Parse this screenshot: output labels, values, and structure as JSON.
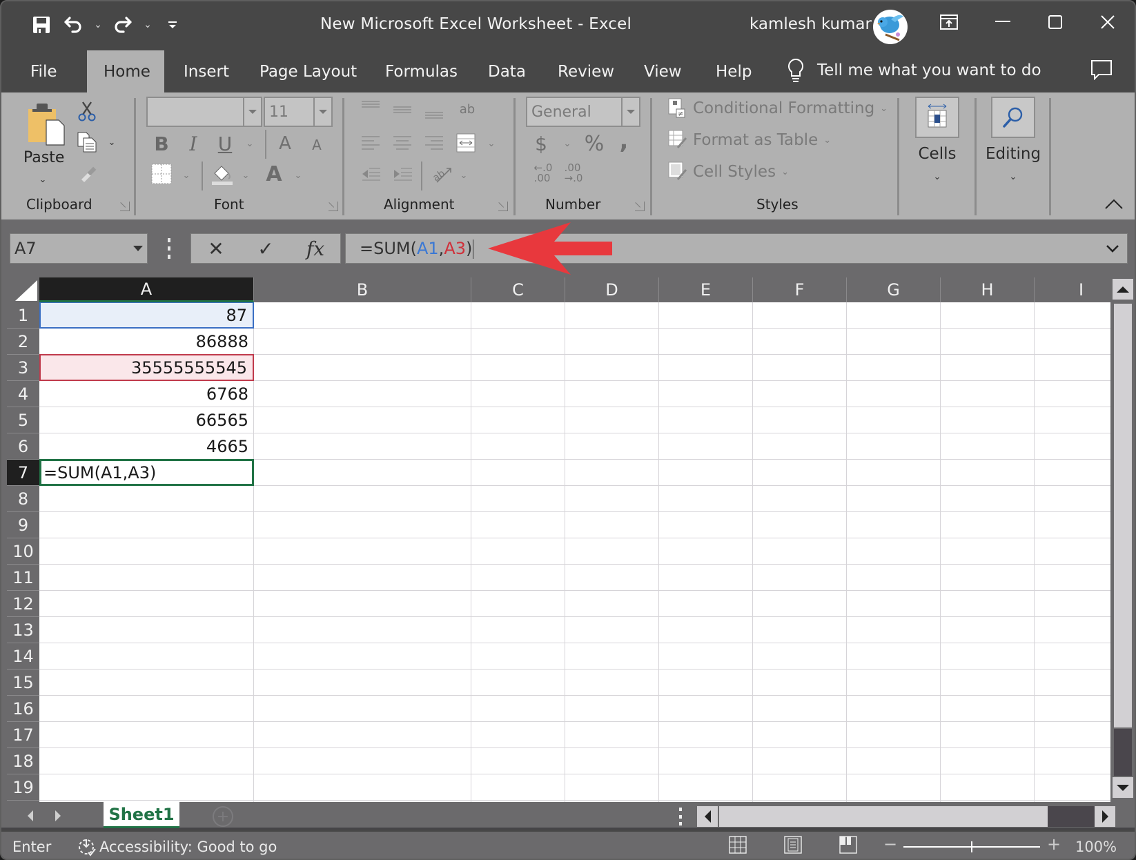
{
  "window": {
    "title": "New Microsoft Excel Worksheet  -  Excel",
    "user_name": "kamlesh kumar"
  },
  "quick_access": {
    "save": "save-icon",
    "undo": "undo-icon",
    "redo": "redo-icon",
    "customize": "customize-toolbar-icon"
  },
  "tabs": [
    {
      "label": "File"
    },
    {
      "label": "Home",
      "active": true
    },
    {
      "label": "Insert"
    },
    {
      "label": "Page Layout"
    },
    {
      "label": "Formulas"
    },
    {
      "label": "Data"
    },
    {
      "label": "Review"
    },
    {
      "label": "View"
    },
    {
      "label": "Help"
    }
  ],
  "tell_me": {
    "placeholder": "Tell me what you want to do"
  },
  "ribbon": {
    "clipboard": {
      "label": "Clipboard",
      "paste_label": "Paste"
    },
    "font": {
      "label": "Font",
      "font_name": "",
      "font_size": "11",
      "bold": "B",
      "italic": "I",
      "underline": "U",
      "grow": "A",
      "shrink": "A",
      "font_color": "A"
    },
    "alignment": {
      "label": "Alignment",
      "wrap": "ab"
    },
    "number": {
      "label": "Number",
      "format": "General",
      "currency": "$",
      "percent": "%",
      "comma": ",",
      "inc_decimal": "←.0\n.00",
      "dec_decimal": ".00\n→.0"
    },
    "styles": {
      "label": "Styles",
      "conditional_formatting": "Conditional Formatting",
      "format_as_table": "Format as Table",
      "cell_styles": "Cell Styles"
    },
    "cells": {
      "label": "Cells"
    },
    "editing": {
      "label": "Editing"
    }
  },
  "formula_bar": {
    "name_box": "A7",
    "cancel": "✕",
    "enter": "✓",
    "fx": "fx",
    "formula_prefix": "=SUM(",
    "ref1": "A1",
    "comma": ",",
    "ref2": "A3",
    "formula_suffix": ")"
  },
  "colors": {
    "ref1": "#3a78d4",
    "ref2": "#d0303a",
    "excel_green": "#217346",
    "annotation_arrow": "#e8383d"
  },
  "sheet": {
    "columns": [
      "A",
      "B",
      "C",
      "D",
      "E",
      "F",
      "G",
      "H",
      "I"
    ],
    "rows": [
      "1",
      "2",
      "3",
      "4",
      "5",
      "6",
      "7",
      "8",
      "9",
      "10",
      "11",
      "12",
      "13",
      "14",
      "15",
      "16",
      "17",
      "18",
      "19"
    ],
    "selected_column": "A",
    "selected_row": "7",
    "cells": [
      {
        "ref": "A1",
        "value": "87"
      },
      {
        "ref": "A2",
        "value": "86888"
      },
      {
        "ref": "A3",
        "value": "35555555545"
      },
      {
        "ref": "A4",
        "value": "6768"
      },
      {
        "ref": "A5",
        "value": "66565"
      },
      {
        "ref": "A6",
        "value": "4665"
      },
      {
        "ref": "A7",
        "value": "=SUM(A1,A3)"
      }
    ]
  },
  "sheet_tabs": [
    {
      "label": "Sheet1",
      "active": true
    }
  ],
  "status_bar": {
    "mode": "Enter",
    "accessibility": "Accessibility: Good to go",
    "zoom_minus": "−",
    "zoom_plus": "+",
    "zoom_level": "100%",
    "zoom_fraction": 0.5
  }
}
